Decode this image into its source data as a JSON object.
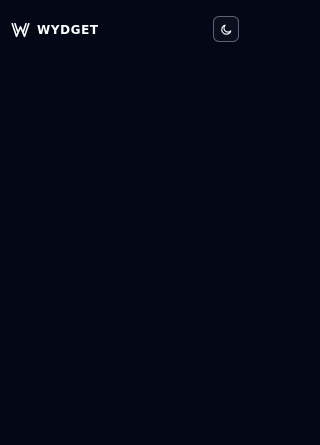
{
  "header": {
    "brand": {
      "name": "WYDGET",
      "logo_icon": "wydget-logo-icon"
    },
    "theme_toggle": {
      "icon": "moon-icon",
      "mode": "dark"
    }
  },
  "colors": {
    "background": "#040716",
    "text": "#ffffff",
    "toggle_border": "#5b6072"
  }
}
